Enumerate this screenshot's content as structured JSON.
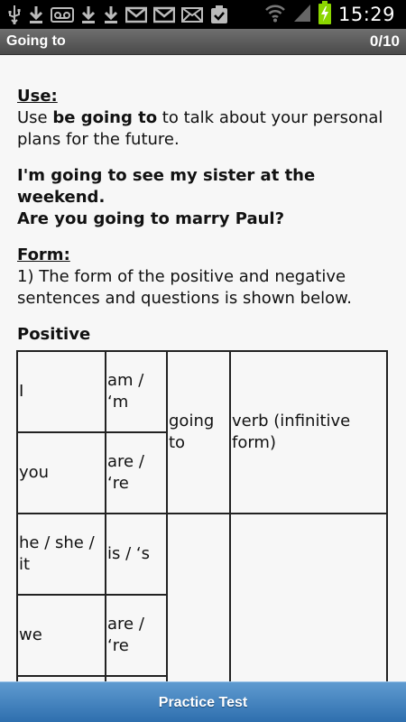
{
  "status_bar": {
    "icons": [
      "usb-icon",
      "download-icon",
      "voicemail-icon",
      "download-icon",
      "download-icon",
      "gmail-icon",
      "gmail-icon",
      "email-icon",
      "clipboard-check-icon",
      "wifi-icon",
      "signal-icon",
      "battery-charging-icon"
    ],
    "time": "15:29"
  },
  "header": {
    "title": "Going to",
    "score": "0/10"
  },
  "lesson": {
    "use_heading": "Use:",
    "use_text_pre": "Use ",
    "use_text_bold": "be going to",
    "use_text_post": " to talk about your personal plans for the future.",
    "example_1": "I'm going to see my sister at the weekend.",
    "example_2": "Are you going to marry Paul?",
    "form_heading": "Form:",
    "form_text": "1)  The form of the positive and negative sentences and questions is shown below.",
    "positive_heading": "Positive"
  },
  "table": {
    "rows": [
      {
        "subject": "I",
        "verb": "am / ‘m"
      },
      {
        "subject": "you",
        "verb": "are / ‘re"
      },
      {
        "subject": "he / she / it",
        "verb": "is / ‘s"
      },
      {
        "subject": "we",
        "verb": "are / ‘re"
      }
    ],
    "going_to": "going to",
    "verb_form": "verb (infinitive form)"
  },
  "footer": {
    "button_label": "Practice Test",
    "accent_color": "#3b7dbd"
  }
}
